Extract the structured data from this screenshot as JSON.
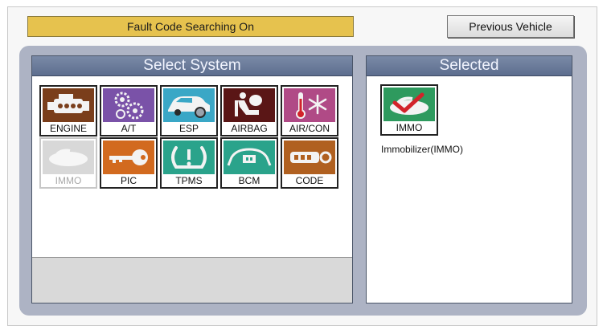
{
  "header": {
    "status_text": "Fault Code Searching On",
    "previous_vehicle_label": "Previous Vehicle"
  },
  "select_system": {
    "title": "Select System",
    "tiles": [
      {
        "label": "ENGINE",
        "icon": "engine-icon",
        "color": "#7a3e1b",
        "enabled": true
      },
      {
        "label": "A/T",
        "icon": "gears-icon",
        "color": "#7a52a8",
        "enabled": true
      },
      {
        "label": "ESP",
        "icon": "car-icon",
        "color": "#3aa7c6",
        "enabled": true
      },
      {
        "label": "AIRBAG",
        "icon": "airbag-seat-icon",
        "color": "#5a1616",
        "enabled": true
      },
      {
        "label": "AIR/CON",
        "icon": "thermometer-snowflake-icon",
        "color": "#b04a86",
        "enabled": true
      },
      {
        "label": "IMMO",
        "icon": "key-car-icon",
        "color": "#cfcfcf",
        "enabled": false
      },
      {
        "label": "PIC",
        "icon": "key-icon",
        "color": "#d26a1f",
        "enabled": true
      },
      {
        "label": "TPMS",
        "icon": "tire-pressure-icon",
        "color": "#2aa38b",
        "enabled": true
      },
      {
        "label": "BCM",
        "icon": "car-module-icon",
        "color": "#2aa38b",
        "enabled": true
      },
      {
        "label": "CODE",
        "icon": "key-fob-icon",
        "color": "#b06020",
        "enabled": true
      }
    ]
  },
  "selected": {
    "title": "Selected",
    "tile": {
      "label": "IMMO",
      "icon": "immobilizer-check-icon",
      "color": "#2e9a5e"
    },
    "description": "Immobilizer(IMMO)"
  }
}
